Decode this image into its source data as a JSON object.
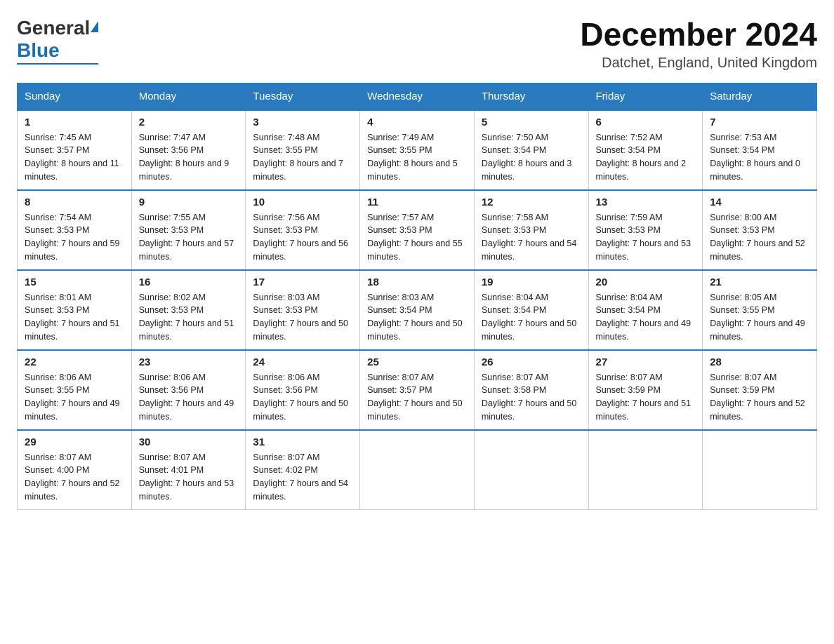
{
  "header": {
    "month_year": "December 2024",
    "location": "Datchet, England, United Kingdom",
    "logo_general": "General",
    "logo_blue": "Blue"
  },
  "days_of_week": [
    "Sunday",
    "Monday",
    "Tuesday",
    "Wednesday",
    "Thursday",
    "Friday",
    "Saturday"
  ],
  "weeks": [
    [
      {
        "day": "1",
        "sunrise": "7:45 AM",
        "sunset": "3:57 PM",
        "daylight": "8 hours and 11 minutes."
      },
      {
        "day": "2",
        "sunrise": "7:47 AM",
        "sunset": "3:56 PM",
        "daylight": "8 hours and 9 minutes."
      },
      {
        "day": "3",
        "sunrise": "7:48 AM",
        "sunset": "3:55 PM",
        "daylight": "8 hours and 7 minutes."
      },
      {
        "day": "4",
        "sunrise": "7:49 AM",
        "sunset": "3:55 PM",
        "daylight": "8 hours and 5 minutes."
      },
      {
        "day": "5",
        "sunrise": "7:50 AM",
        "sunset": "3:54 PM",
        "daylight": "8 hours and 3 minutes."
      },
      {
        "day": "6",
        "sunrise": "7:52 AM",
        "sunset": "3:54 PM",
        "daylight": "8 hours and 2 minutes."
      },
      {
        "day": "7",
        "sunrise": "7:53 AM",
        "sunset": "3:54 PM",
        "daylight": "8 hours and 0 minutes."
      }
    ],
    [
      {
        "day": "8",
        "sunrise": "7:54 AM",
        "sunset": "3:53 PM",
        "daylight": "7 hours and 59 minutes."
      },
      {
        "day": "9",
        "sunrise": "7:55 AM",
        "sunset": "3:53 PM",
        "daylight": "7 hours and 57 minutes."
      },
      {
        "day": "10",
        "sunrise": "7:56 AM",
        "sunset": "3:53 PM",
        "daylight": "7 hours and 56 minutes."
      },
      {
        "day": "11",
        "sunrise": "7:57 AM",
        "sunset": "3:53 PM",
        "daylight": "7 hours and 55 minutes."
      },
      {
        "day": "12",
        "sunrise": "7:58 AM",
        "sunset": "3:53 PM",
        "daylight": "7 hours and 54 minutes."
      },
      {
        "day": "13",
        "sunrise": "7:59 AM",
        "sunset": "3:53 PM",
        "daylight": "7 hours and 53 minutes."
      },
      {
        "day": "14",
        "sunrise": "8:00 AM",
        "sunset": "3:53 PM",
        "daylight": "7 hours and 52 minutes."
      }
    ],
    [
      {
        "day": "15",
        "sunrise": "8:01 AM",
        "sunset": "3:53 PM",
        "daylight": "7 hours and 51 minutes."
      },
      {
        "day": "16",
        "sunrise": "8:02 AM",
        "sunset": "3:53 PM",
        "daylight": "7 hours and 51 minutes."
      },
      {
        "day": "17",
        "sunrise": "8:03 AM",
        "sunset": "3:53 PM",
        "daylight": "7 hours and 50 minutes."
      },
      {
        "day": "18",
        "sunrise": "8:03 AM",
        "sunset": "3:54 PM",
        "daylight": "7 hours and 50 minutes."
      },
      {
        "day": "19",
        "sunrise": "8:04 AM",
        "sunset": "3:54 PM",
        "daylight": "7 hours and 50 minutes."
      },
      {
        "day": "20",
        "sunrise": "8:04 AM",
        "sunset": "3:54 PM",
        "daylight": "7 hours and 49 minutes."
      },
      {
        "day": "21",
        "sunrise": "8:05 AM",
        "sunset": "3:55 PM",
        "daylight": "7 hours and 49 minutes."
      }
    ],
    [
      {
        "day": "22",
        "sunrise": "8:06 AM",
        "sunset": "3:55 PM",
        "daylight": "7 hours and 49 minutes."
      },
      {
        "day": "23",
        "sunrise": "8:06 AM",
        "sunset": "3:56 PM",
        "daylight": "7 hours and 49 minutes."
      },
      {
        "day": "24",
        "sunrise": "8:06 AM",
        "sunset": "3:56 PM",
        "daylight": "7 hours and 50 minutes."
      },
      {
        "day": "25",
        "sunrise": "8:07 AM",
        "sunset": "3:57 PM",
        "daylight": "7 hours and 50 minutes."
      },
      {
        "day": "26",
        "sunrise": "8:07 AM",
        "sunset": "3:58 PM",
        "daylight": "7 hours and 50 minutes."
      },
      {
        "day": "27",
        "sunrise": "8:07 AM",
        "sunset": "3:59 PM",
        "daylight": "7 hours and 51 minutes."
      },
      {
        "day": "28",
        "sunrise": "8:07 AM",
        "sunset": "3:59 PM",
        "daylight": "7 hours and 52 minutes."
      }
    ],
    [
      {
        "day": "29",
        "sunrise": "8:07 AM",
        "sunset": "4:00 PM",
        "daylight": "7 hours and 52 minutes."
      },
      {
        "day": "30",
        "sunrise": "8:07 AM",
        "sunset": "4:01 PM",
        "daylight": "7 hours and 53 minutes."
      },
      {
        "day": "31",
        "sunrise": "8:07 AM",
        "sunset": "4:02 PM",
        "daylight": "7 hours and 54 minutes."
      },
      null,
      null,
      null,
      null
    ]
  ],
  "labels": {
    "sunrise": "Sunrise:",
    "sunset": "Sunset:",
    "daylight": "Daylight:"
  }
}
